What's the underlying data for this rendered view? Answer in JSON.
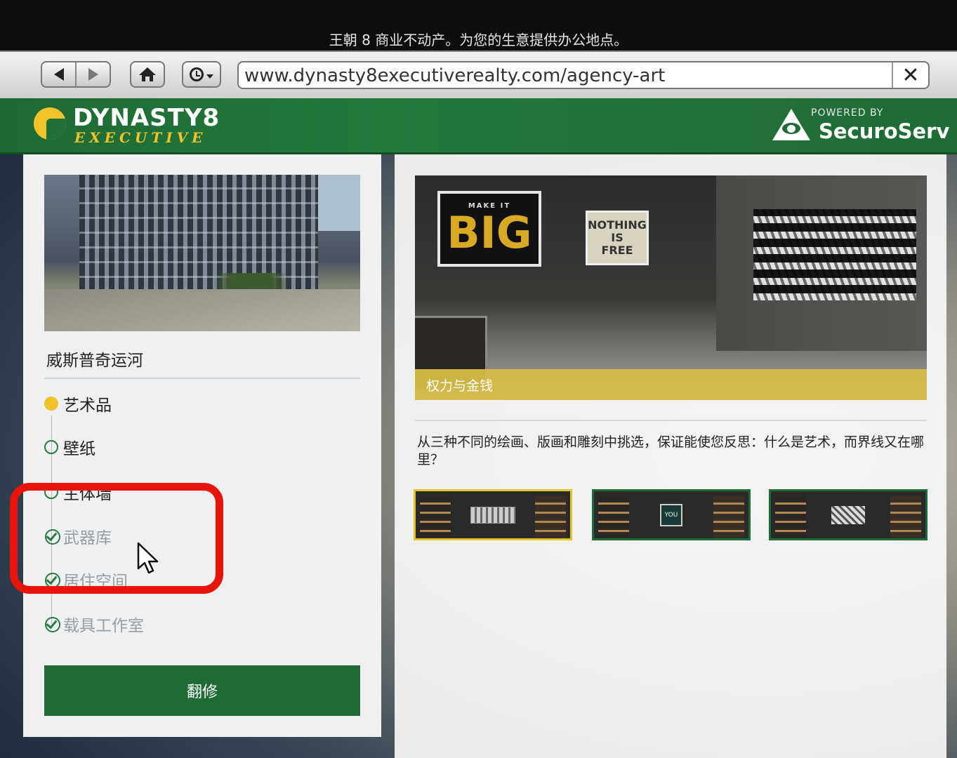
{
  "window": {
    "title": "王朝 8 商业不动产。为您的生意提供办公地点。"
  },
  "browser": {
    "url": "www.dynasty8executiverealty.com/agency-art",
    "close_label": "✕",
    "icons": [
      "back-icon",
      "forward-icon",
      "home-icon",
      "history-icon",
      "close-icon"
    ]
  },
  "header": {
    "brand_top": "DYNASTY8",
    "brand_bottom": "EXECUTIVE",
    "powered_by": "POWERED BY",
    "partner": "SecuroServ"
  },
  "sidebar": {
    "location": "威斯普奇运河",
    "items": [
      {
        "label": "艺术品",
        "state": "active"
      },
      {
        "label": "壁纸",
        "state": "available"
      },
      {
        "label": "主体墙",
        "state": "available"
      },
      {
        "label": "武器库",
        "state": "owned"
      },
      {
        "label": "居住空间",
        "state": "owned"
      },
      {
        "label": "载具工作室",
        "state": "owned"
      }
    ],
    "renovate_label": "翻修"
  },
  "main": {
    "preview_caption": "权力与金钱",
    "preview_art": {
      "big_small": "MAKE IT",
      "big_large": "BIG",
      "nothing": [
        "NOTHING",
        "IS",
        "FREE"
      ]
    },
    "description": "从三种不同的绘画、版画和雕刻中挑选，保证能使您反思：什么是艺术，而界线又在哪里？",
    "options": [
      {
        "name": "option-1",
        "selected": true,
        "piece_text": ""
      },
      {
        "name": "option-2",
        "selected": false,
        "piece_text": "YOU"
      },
      {
        "name": "option-3",
        "selected": false,
        "piece_text": ""
      }
    ]
  },
  "colors": {
    "brand_green": "#1e6b34",
    "accent_gold": "#f2c22a",
    "annotation_red": "#e8140c"
  }
}
